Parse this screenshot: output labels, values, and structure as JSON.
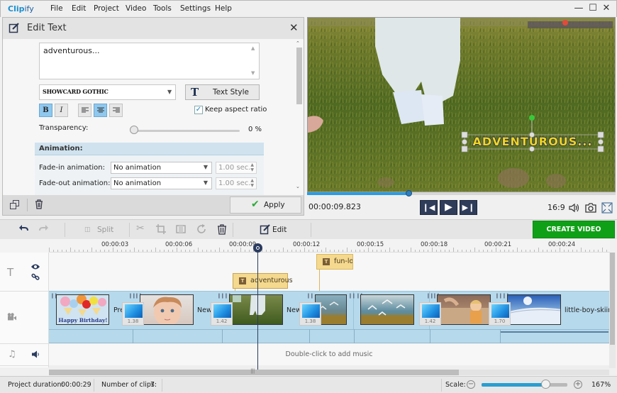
{
  "app": {
    "name_part1": "Clip",
    "name_part2": "ify",
    "menu": [
      "File",
      "Edit",
      "Project",
      "Video",
      "Tools",
      "Settings",
      "Help"
    ],
    "window_controls": {
      "minimize": "minimize-icon",
      "maximize": "maximize-icon",
      "close": "close-icon"
    }
  },
  "edit_panel": {
    "title": "Edit Text",
    "text_value": "adventurous...",
    "font": "SHOWCARD GOTHIC",
    "text_style_label": "Text Style",
    "bold_active": true,
    "italic_active": false,
    "align": "center",
    "keep_aspect_label": "Keep aspect ratio",
    "keep_aspect_checked": true,
    "transparency_label": "Transparency:",
    "transparency_value": "0 %",
    "transparency_percent": 0,
    "animation_header": "Animation:",
    "fade_in_label": "Fade-in animation:",
    "fade_in_value": "No animation",
    "fade_in_duration": "1.00 sec.",
    "fade_out_label": "Fade-out animation:",
    "fade_out_value": "No animation",
    "fade_out_duration": "1.00 sec.",
    "apply_label": "Apply"
  },
  "preview": {
    "overlay_text": "ADVENTUROUS...",
    "timecode": "00:00:09.823",
    "progress_fraction": 0.33,
    "aspect_ratio": "16:9"
  },
  "toolbar": {
    "split_label": "Split",
    "edit_label": "Edit",
    "create_video_label": "CREATE VIDEO"
  },
  "timeline": {
    "ruler_labels": [
      "00:00:03",
      "00:00:06",
      "00:00:09",
      "00:00:12",
      "00:00:15",
      "00:00:18",
      "00:00:21",
      "00:00:24"
    ],
    "text_clips": [
      "adventurous",
      "fun-lo"
    ],
    "video_clip_labels": [
      "Pre",
      "New",
      "New",
      "little-boy-skiing"
    ],
    "transitions": [
      "1.38",
      "1.42",
      "1.38",
      "1.42",
      "1.70"
    ],
    "music_hint": "Double-click to add music"
  },
  "status": {
    "duration_label": "Project duration:",
    "duration_value": "00:00:29",
    "clips_label": "Number of clips:",
    "clips_value": "7",
    "scale_label": "Scale:",
    "scale_value": "167%",
    "scale_fraction": 0.74
  }
}
